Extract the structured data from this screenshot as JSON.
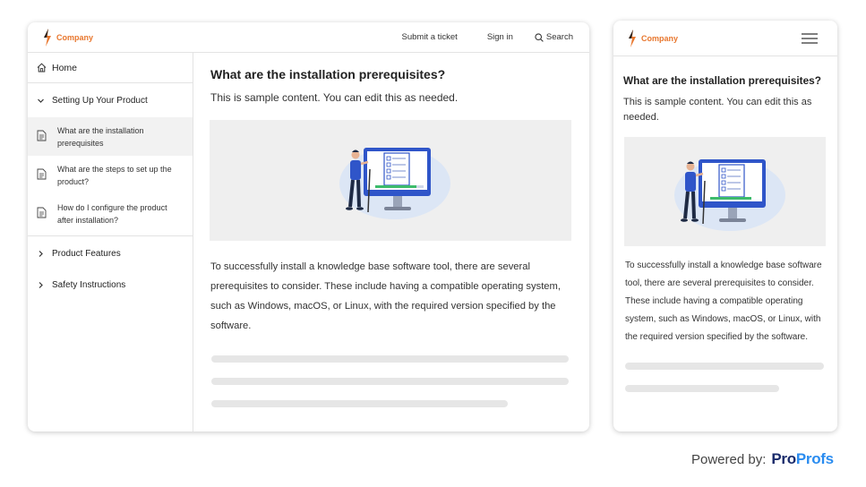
{
  "colors": {
    "accent": "#e8772e",
    "brand_dark": "#1a2b6b",
    "brand_blue": "#2a8cf0",
    "illustration_blue": "#2f55c9"
  },
  "header": {
    "logo_text": "Company",
    "submit_ticket": "Submit a ticket",
    "sign_in": "Sign in",
    "search": "Search"
  },
  "sidebar": {
    "home": "Home",
    "open_section": "Setting Up Your Product",
    "articles": [
      "What are the installation prerequisites",
      "What are the steps to set up the product?",
      "How do I configure the product after installation?"
    ],
    "sections": [
      "Product Features",
      "Safety Instructions"
    ]
  },
  "article": {
    "title": "What are the installation prerequisites?",
    "lead": "This is sample content. You can edit this as needed.",
    "body": "To successfully install a knowledge base software tool, there are several prerequisites to consider. These include having a compatible operating system, such as Windows, macOS, or Linux, with the required version specified by the software."
  },
  "mobile": {
    "logo_text": "Company",
    "menu_icon": "hamburger-icon"
  },
  "footer": {
    "powered_by": "Powered by:",
    "brand_part1": "Pro",
    "brand_part2": "Profs"
  }
}
